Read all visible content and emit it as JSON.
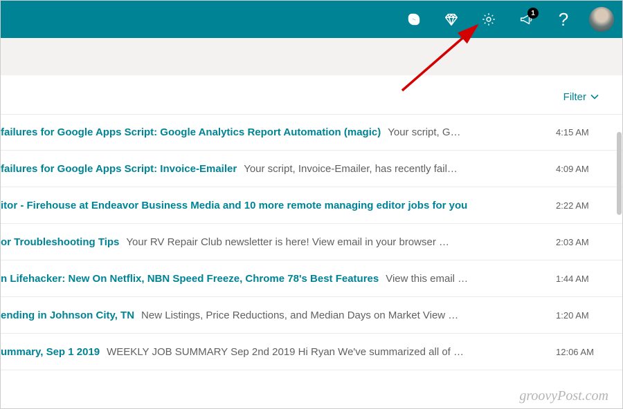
{
  "header": {
    "notification_badge": "1"
  },
  "filter": {
    "label": "Filter"
  },
  "emails": [
    {
      "subject": "failures for Google Apps Script: Google Analytics Report Automation (magic)",
      "preview": "Your script, G…",
      "time": "4:15 AM"
    },
    {
      "subject": "failures for Google Apps Script: Invoice-Emailer",
      "preview": "Your script, Invoice-Emailer, has recently fail…",
      "time": "4:09 AM"
    },
    {
      "subject": "itor - Firehouse at Endeavor Business Media and 10 more remote managing editor jobs for you",
      "preview": "",
      "time": "2:22 AM"
    },
    {
      "subject": "or Troubleshooting Tips",
      "preview": "Your RV Repair Club newsletter is here! View email in your browser …",
      "time": "2:03 AM"
    },
    {
      "subject": "n Lifehacker: New On Netflix, NBN Speed Freeze, Chrome 78's Best Features",
      "preview": "View this email …",
      "time": "1:44 AM"
    },
    {
      "subject": "ending in Johnson City, TN",
      "preview": "New Listings, Price Reductions, and Median Days on Market View …",
      "time": "1:20 AM"
    },
    {
      "subject": "ummary, Sep 1 2019",
      "preview": "WEEKLY JOB SUMMARY Sep 2nd 2019 Hi Ryan We've summarized all of …",
      "time": "12:06 AM"
    }
  ],
  "watermark": "groovyPost.com"
}
